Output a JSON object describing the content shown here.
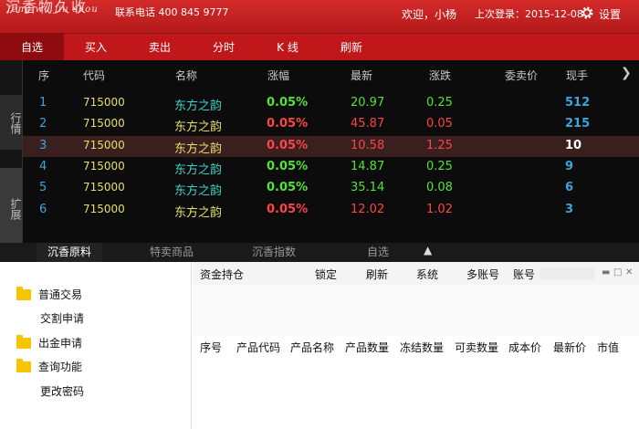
{
  "header": {
    "logo_main": "沉香物久收",
    "logo_sub": "feng wu jiu shou",
    "hotline": "联系电话 400 845 9777",
    "welcome": "欢迎，小杨",
    "last_login": "上次登录：2015-12-08",
    "settings_label": "设置"
  },
  "nav": [
    "自选",
    "买入",
    "卖出",
    "分时",
    "K 线",
    "刷新"
  ],
  "side_tabs": {
    "quotes": "行情",
    "expand": "扩展"
  },
  "table": {
    "headers": [
      "序",
      "代码",
      "名称",
      "涨幅",
      "最新",
      "涨跌",
      "委卖价",
      "现手"
    ],
    "rows": [
      {
        "idx": "1",
        "code": "715000",
        "name": "东方之韵",
        "pct": "0.05%",
        "price": "20.97",
        "chg": "0.25",
        "hand": "512",
        "dir": "up"
      },
      {
        "idx": "2",
        "code": "715000",
        "name": "东方之韵",
        "pct": "0.05%",
        "price": "45.87",
        "chg": "0.05",
        "hand": "215",
        "dir": "down"
      },
      {
        "idx": "3",
        "code": "715000",
        "name": "东方之韵",
        "pct": "0.05%",
        "price": "10.58",
        "chg": "1.25",
        "hand": "10",
        "dir": "down"
      },
      {
        "idx": "4",
        "code": "715000",
        "name": "东方之韵",
        "pct": "0.05%",
        "price": "14.87",
        "chg": "0.25",
        "hand": "9",
        "dir": "up"
      },
      {
        "idx": "5",
        "code": "715000",
        "name": "东方之韵",
        "pct": "0.05%",
        "price": "35.14",
        "chg": "0.08",
        "hand": "6",
        "dir": "up"
      },
      {
        "idx": "6",
        "code": "715000",
        "name": "东方之韵",
        "pct": "0.05%",
        "price": "12.02",
        "chg": "1.02",
        "hand": "3",
        "dir": "down"
      }
    ],
    "selected_row": 3
  },
  "bottom_tabs": [
    "沉香原料",
    "特卖商品",
    "沉香指数",
    "自选"
  ],
  "left_menu": [
    "普通交易",
    "交割申请",
    "出金申请",
    "查询功能",
    "更改密码"
  ],
  "toolbar": [
    "资金持仓",
    "锁定",
    "刷新",
    "系统",
    "多账号",
    "账号"
  ],
  "columns": [
    "序号",
    "产品代码",
    "产品名称",
    "产品数量",
    "冻结数量",
    "可卖数量",
    "成本价",
    "最新价",
    "市值"
  ],
  "colors": {
    "up": "#55e03a",
    "down": "#ff4444",
    "accent": "#c0171b"
  }
}
